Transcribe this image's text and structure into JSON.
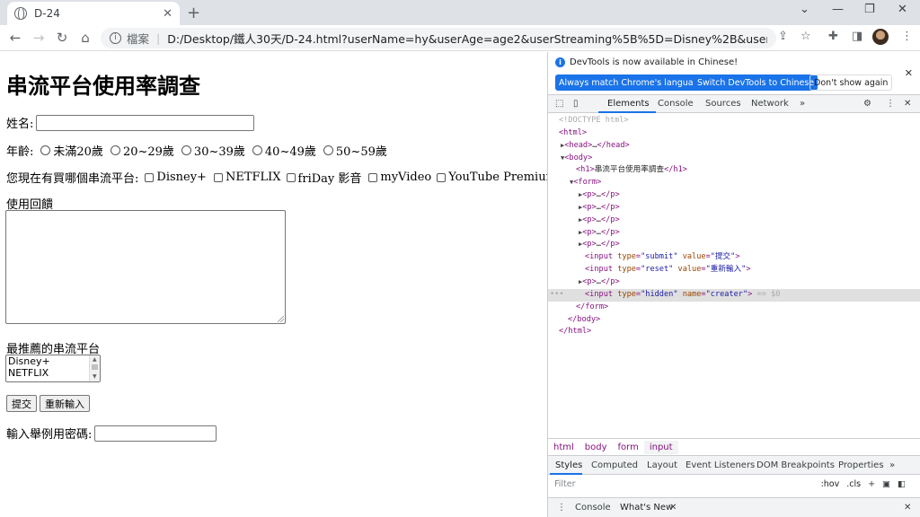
{
  "browser": {
    "tab_title": "D-24",
    "tab_close": "✕",
    "new_tab": "+",
    "window_controls": [
      "⌄",
      "—",
      "❐",
      "✕"
    ],
    "nav": {
      "back": "←",
      "forward": "→",
      "reload": "↻",
      "home": "⌂"
    },
    "security_label": "檔案",
    "url": "D:/Desktop/鐵人30天/D-24.html?userName=hy&userAge=age2&userStreaming%5B%5D=Disney%2B&userStreaming%5B%5D...",
    "toolbar_icons": [
      "share-icon",
      "star-icon",
      "extensions-icon",
      "sidepanel-icon",
      "avatar",
      "menu-icon"
    ]
  },
  "page": {
    "heading": "串流平台使用率調查",
    "name_label": "姓名:",
    "age_label": "年齡:",
    "age_options": [
      "未滿20歲",
      "20~29歲",
      "30~39歲",
      "40~49歲",
      "50~59歲"
    ],
    "platform_label": "您現在有買哪個串流平台:",
    "platform_options": [
      "Disney+",
      "NETFLIX",
      "friDay 影音",
      "myVideo",
      "YouTube Premium"
    ],
    "feedback_label": "使用回饋",
    "recommend_label": "最推薦的串流平台",
    "recommend_options": [
      "Disney+",
      "NETFLIX"
    ],
    "submit_label": "提交",
    "reset_label": "重新輸入",
    "password_label": "輸入舉例用密碼:"
  },
  "devtools": {
    "banner_message": "DevTools is now available in Chinese!",
    "banner_btn_match": "Always match Chrome's language",
    "banner_btn_switch": "Switch DevTools to Chinese",
    "banner_btn_dismiss": "Don't show again",
    "tabs": [
      "Elements",
      "Console",
      "Sources",
      "Network",
      "»"
    ],
    "dom": {
      "doctype": "<!DOCTYPE html>",
      "h1_text": "串流平台使用率調查",
      "submit_value": "\"提交\"",
      "reset_value": "\"重新輸入\"",
      "hidden_name": "\"creater\"",
      "selected_marker": "== $0"
    },
    "breadcrumbs": [
      "html",
      "body",
      "form",
      "input"
    ],
    "styles_tabs": [
      "Styles",
      "Computed",
      "Layout",
      "Event Listeners",
      "DOM Breakpoints",
      "Properties",
      "»"
    ],
    "filter_placeholder": "Filter",
    "filter_hov": ":hov",
    "filter_cls": ".cls",
    "drawer_tabs": [
      "Console",
      "What's New"
    ]
  },
  "colors": {
    "accent": "#1a73e8",
    "tag": "#881280",
    "attr": "#994500",
    "value": "#1a1aa6"
  }
}
